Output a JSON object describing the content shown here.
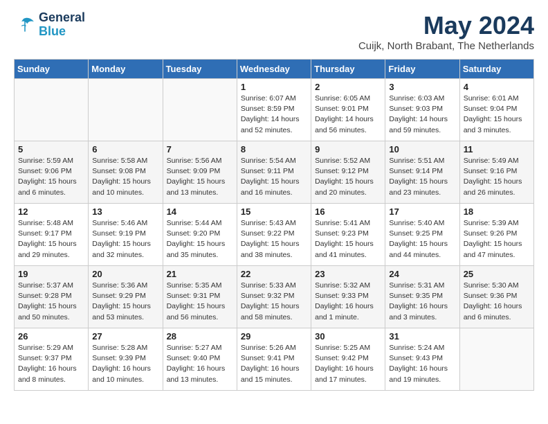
{
  "logo": {
    "line1": "General",
    "line2": "Blue"
  },
  "title": "May 2024",
  "location": "Cuijk, North Brabant, The Netherlands",
  "weekdays": [
    "Sunday",
    "Monday",
    "Tuesday",
    "Wednesday",
    "Thursday",
    "Friday",
    "Saturday"
  ],
  "weeks": [
    [
      {
        "day": "",
        "content": ""
      },
      {
        "day": "",
        "content": ""
      },
      {
        "day": "",
        "content": ""
      },
      {
        "day": "1",
        "content": "Sunrise: 6:07 AM\nSunset: 8:59 PM\nDaylight: 14 hours\nand 52 minutes."
      },
      {
        "day": "2",
        "content": "Sunrise: 6:05 AM\nSunset: 9:01 PM\nDaylight: 14 hours\nand 56 minutes."
      },
      {
        "day": "3",
        "content": "Sunrise: 6:03 AM\nSunset: 9:03 PM\nDaylight: 14 hours\nand 59 minutes."
      },
      {
        "day": "4",
        "content": "Sunrise: 6:01 AM\nSunset: 9:04 PM\nDaylight: 15 hours\nand 3 minutes."
      }
    ],
    [
      {
        "day": "5",
        "content": "Sunrise: 5:59 AM\nSunset: 9:06 PM\nDaylight: 15 hours\nand 6 minutes."
      },
      {
        "day": "6",
        "content": "Sunrise: 5:58 AM\nSunset: 9:08 PM\nDaylight: 15 hours\nand 10 minutes."
      },
      {
        "day": "7",
        "content": "Sunrise: 5:56 AM\nSunset: 9:09 PM\nDaylight: 15 hours\nand 13 minutes."
      },
      {
        "day": "8",
        "content": "Sunrise: 5:54 AM\nSunset: 9:11 PM\nDaylight: 15 hours\nand 16 minutes."
      },
      {
        "day": "9",
        "content": "Sunrise: 5:52 AM\nSunset: 9:12 PM\nDaylight: 15 hours\nand 20 minutes."
      },
      {
        "day": "10",
        "content": "Sunrise: 5:51 AM\nSunset: 9:14 PM\nDaylight: 15 hours\nand 23 minutes."
      },
      {
        "day": "11",
        "content": "Sunrise: 5:49 AM\nSunset: 9:16 PM\nDaylight: 15 hours\nand 26 minutes."
      }
    ],
    [
      {
        "day": "12",
        "content": "Sunrise: 5:48 AM\nSunset: 9:17 PM\nDaylight: 15 hours\nand 29 minutes."
      },
      {
        "day": "13",
        "content": "Sunrise: 5:46 AM\nSunset: 9:19 PM\nDaylight: 15 hours\nand 32 minutes."
      },
      {
        "day": "14",
        "content": "Sunrise: 5:44 AM\nSunset: 9:20 PM\nDaylight: 15 hours\nand 35 minutes."
      },
      {
        "day": "15",
        "content": "Sunrise: 5:43 AM\nSunset: 9:22 PM\nDaylight: 15 hours\nand 38 minutes."
      },
      {
        "day": "16",
        "content": "Sunrise: 5:41 AM\nSunset: 9:23 PM\nDaylight: 15 hours\nand 41 minutes."
      },
      {
        "day": "17",
        "content": "Sunrise: 5:40 AM\nSunset: 9:25 PM\nDaylight: 15 hours\nand 44 minutes."
      },
      {
        "day": "18",
        "content": "Sunrise: 5:39 AM\nSunset: 9:26 PM\nDaylight: 15 hours\nand 47 minutes."
      }
    ],
    [
      {
        "day": "19",
        "content": "Sunrise: 5:37 AM\nSunset: 9:28 PM\nDaylight: 15 hours\nand 50 minutes."
      },
      {
        "day": "20",
        "content": "Sunrise: 5:36 AM\nSunset: 9:29 PM\nDaylight: 15 hours\nand 53 minutes."
      },
      {
        "day": "21",
        "content": "Sunrise: 5:35 AM\nSunset: 9:31 PM\nDaylight: 15 hours\nand 56 minutes."
      },
      {
        "day": "22",
        "content": "Sunrise: 5:33 AM\nSunset: 9:32 PM\nDaylight: 15 hours\nand 58 minutes."
      },
      {
        "day": "23",
        "content": "Sunrise: 5:32 AM\nSunset: 9:33 PM\nDaylight: 16 hours\nand 1 minute."
      },
      {
        "day": "24",
        "content": "Sunrise: 5:31 AM\nSunset: 9:35 PM\nDaylight: 16 hours\nand 3 minutes."
      },
      {
        "day": "25",
        "content": "Sunrise: 5:30 AM\nSunset: 9:36 PM\nDaylight: 16 hours\nand 6 minutes."
      }
    ],
    [
      {
        "day": "26",
        "content": "Sunrise: 5:29 AM\nSunset: 9:37 PM\nDaylight: 16 hours\nand 8 minutes."
      },
      {
        "day": "27",
        "content": "Sunrise: 5:28 AM\nSunset: 9:39 PM\nDaylight: 16 hours\nand 10 minutes."
      },
      {
        "day": "28",
        "content": "Sunrise: 5:27 AM\nSunset: 9:40 PM\nDaylight: 16 hours\nand 13 minutes."
      },
      {
        "day": "29",
        "content": "Sunrise: 5:26 AM\nSunset: 9:41 PM\nDaylight: 16 hours\nand 15 minutes."
      },
      {
        "day": "30",
        "content": "Sunrise: 5:25 AM\nSunset: 9:42 PM\nDaylight: 16 hours\nand 17 minutes."
      },
      {
        "day": "31",
        "content": "Sunrise: 5:24 AM\nSunset: 9:43 PM\nDaylight: 16 hours\nand 19 minutes."
      },
      {
        "day": "",
        "content": ""
      }
    ]
  ]
}
